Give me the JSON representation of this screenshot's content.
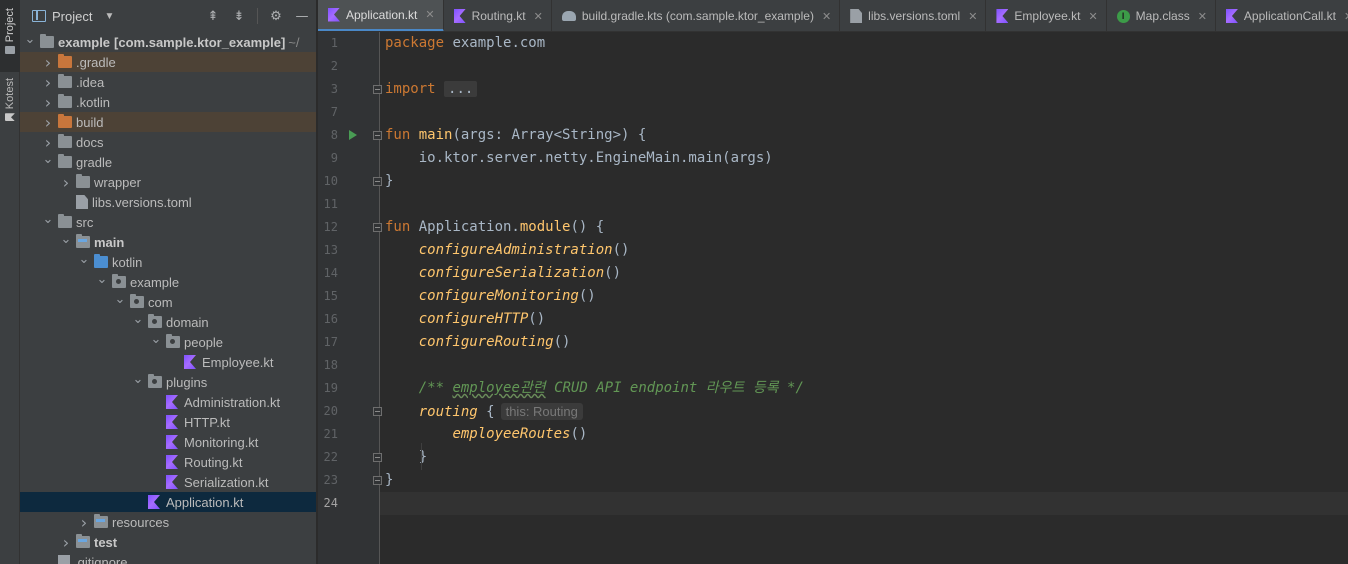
{
  "sidebar_tabs": [
    "Project",
    "Kotest"
  ],
  "project_panel": {
    "title": "Project",
    "actions": [
      "select-opened-file",
      "collapse-all",
      "settings",
      "hide"
    ]
  },
  "tree": [
    {
      "label": "example",
      "suffix": "[com.sample.ktor_example]",
      "path": "~/",
      "depth": 0,
      "expanded": true,
      "icon": "folder",
      "bold": true
    },
    {
      "label": ".gradle",
      "depth": 1,
      "expanded": false,
      "icon": "folder-orange",
      "excluded": true
    },
    {
      "label": ".idea",
      "depth": 1,
      "expanded": false,
      "icon": "folder"
    },
    {
      "label": ".kotlin",
      "depth": 1,
      "expanded": false,
      "icon": "folder"
    },
    {
      "label": "build",
      "depth": 1,
      "expanded": false,
      "icon": "folder-orange",
      "excluded": true
    },
    {
      "label": "docs",
      "depth": 1,
      "expanded": false,
      "icon": "folder"
    },
    {
      "label": "gradle",
      "depth": 1,
      "expanded": true,
      "icon": "folder"
    },
    {
      "label": "wrapper",
      "depth": 2,
      "expanded": false,
      "icon": "folder"
    },
    {
      "label": "libs.versions.toml",
      "depth": 2,
      "icon": "toml"
    },
    {
      "label": "src",
      "depth": 1,
      "expanded": true,
      "icon": "folder"
    },
    {
      "label": "main",
      "depth": 2,
      "expanded": true,
      "icon": "folder-src",
      "bold": true
    },
    {
      "label": "kotlin",
      "depth": 3,
      "expanded": true,
      "icon": "folder-blue"
    },
    {
      "label": "example",
      "depth": 4,
      "expanded": true,
      "icon": "folder-pkg"
    },
    {
      "label": "com",
      "depth": 5,
      "expanded": true,
      "icon": "folder-pkg"
    },
    {
      "label": "domain",
      "depth": 6,
      "expanded": true,
      "icon": "folder-pkg"
    },
    {
      "label": "people",
      "depth": 7,
      "expanded": true,
      "icon": "folder-pkg"
    },
    {
      "label": "Employee.kt",
      "depth": 8,
      "icon": "kt"
    },
    {
      "label": "plugins",
      "depth": 6,
      "expanded": true,
      "icon": "folder-pkg"
    },
    {
      "label": "Administration.kt",
      "depth": 7,
      "icon": "kt"
    },
    {
      "label": "HTTP.kt",
      "depth": 7,
      "icon": "kt"
    },
    {
      "label": "Monitoring.kt",
      "depth": 7,
      "icon": "kt"
    },
    {
      "label": "Routing.kt",
      "depth": 7,
      "icon": "kt"
    },
    {
      "label": "Serialization.kt",
      "depth": 7,
      "icon": "kt"
    },
    {
      "label": "Application.kt",
      "depth": 6,
      "icon": "kt",
      "selected": true
    },
    {
      "label": "resources",
      "depth": 3,
      "expanded": false,
      "icon": "folder-src"
    },
    {
      "label": "test",
      "depth": 2,
      "expanded": false,
      "icon": "folder-src",
      "bold": true
    },
    {
      "label": ".gitignore",
      "depth": 1,
      "icon": "git"
    }
  ],
  "tabs": [
    {
      "label": "Application.kt",
      "icon": "kt",
      "active": true
    },
    {
      "label": "Routing.kt",
      "icon": "kt"
    },
    {
      "label": "build.gradle.kts (com.sample.ktor_example)",
      "icon": "gradle"
    },
    {
      "label": "libs.versions.toml",
      "icon": "toml"
    },
    {
      "label": "Employee.kt",
      "icon": "kt"
    },
    {
      "label": "Map.class",
      "icon": "class"
    },
    {
      "label": "ApplicationCall.kt",
      "icon": "kt"
    }
  ],
  "editor": {
    "current_line": 24,
    "lines": [
      {
        "n": "1",
        "tokens": [
          {
            "t": "package ",
            "c": "kw"
          },
          {
            "t": "example.com"
          }
        ]
      },
      {
        "n": "2",
        "tokens": []
      },
      {
        "n": "3",
        "tokens": [
          {
            "t": "import ",
            "c": "kw"
          },
          {
            "t": "...",
            "c": "fold-box"
          }
        ],
        "fold": "open"
      },
      {
        "n": "7",
        "tokens": []
      },
      {
        "n": "8",
        "tokens": [
          {
            "t": "fun ",
            "c": "kw"
          },
          {
            "t": "main",
            "c": "fn"
          },
          {
            "t": "(args: Array<String>) {"
          }
        ],
        "fold": "open",
        "run": true
      },
      {
        "n": "9",
        "tokens": [
          {
            "t": "    io.ktor.server.netty.EngineMain.main(args)"
          }
        ]
      },
      {
        "n": "10",
        "tokens": [
          {
            "t": "}"
          }
        ],
        "fold": "end"
      },
      {
        "n": "11",
        "tokens": []
      },
      {
        "n": "12",
        "tokens": [
          {
            "t": "fun ",
            "c": "kw"
          },
          {
            "t": "Application."
          },
          {
            "t": "module",
            "c": "fn"
          },
          {
            "t": "() {"
          }
        ],
        "fold": "open"
      },
      {
        "n": "13",
        "tokens": [
          {
            "t": "    "
          },
          {
            "t": "configureAdministration",
            "c": "it"
          },
          {
            "t": "()"
          }
        ]
      },
      {
        "n": "14",
        "tokens": [
          {
            "t": "    "
          },
          {
            "t": "configureSerialization",
            "c": "it"
          },
          {
            "t": "()"
          }
        ]
      },
      {
        "n": "15",
        "tokens": [
          {
            "t": "    "
          },
          {
            "t": "configureMonitoring",
            "c": "it"
          },
          {
            "t": "()"
          }
        ]
      },
      {
        "n": "16",
        "tokens": [
          {
            "t": "    "
          },
          {
            "t": "configureHTTP",
            "c": "it"
          },
          {
            "t": "()"
          }
        ]
      },
      {
        "n": "17",
        "tokens": [
          {
            "t": "    "
          },
          {
            "t": "configureRouting",
            "c": "it"
          },
          {
            "t": "()"
          }
        ]
      },
      {
        "n": "18",
        "tokens": []
      },
      {
        "n": "19",
        "tokens": [
          {
            "t": "    /** ",
            "c": "cm"
          },
          {
            "t": "employee관련",
            "c": "cm wavy"
          },
          {
            "t": " CRUD API endpoint 라우트 등록 */",
            "c": "cm"
          }
        ]
      },
      {
        "n": "20",
        "tokens": [
          {
            "t": "    "
          },
          {
            "t": "routing",
            "c": "it"
          },
          {
            "t": " {"
          },
          {
            "t": "this: Routing",
            "c": "hint"
          }
        ],
        "fold": "open"
      },
      {
        "n": "21",
        "tokens": [
          {
            "t": "        "
          },
          {
            "t": "employeeRoutes",
            "c": "it"
          },
          {
            "t": "()"
          }
        ]
      },
      {
        "n": "22",
        "tokens": [
          {
            "t": "    }"
          }
        ],
        "fold": "end"
      },
      {
        "n": "23",
        "tokens": [
          {
            "t": "}"
          }
        ],
        "fold": "end"
      },
      {
        "n": "24",
        "tokens": []
      }
    ]
  },
  "colors": {
    "keyword": "#cc7832",
    "function": "#ffc66d",
    "comment": "#629755",
    "text": "#a9b7c6",
    "selection": "#0d293e"
  }
}
